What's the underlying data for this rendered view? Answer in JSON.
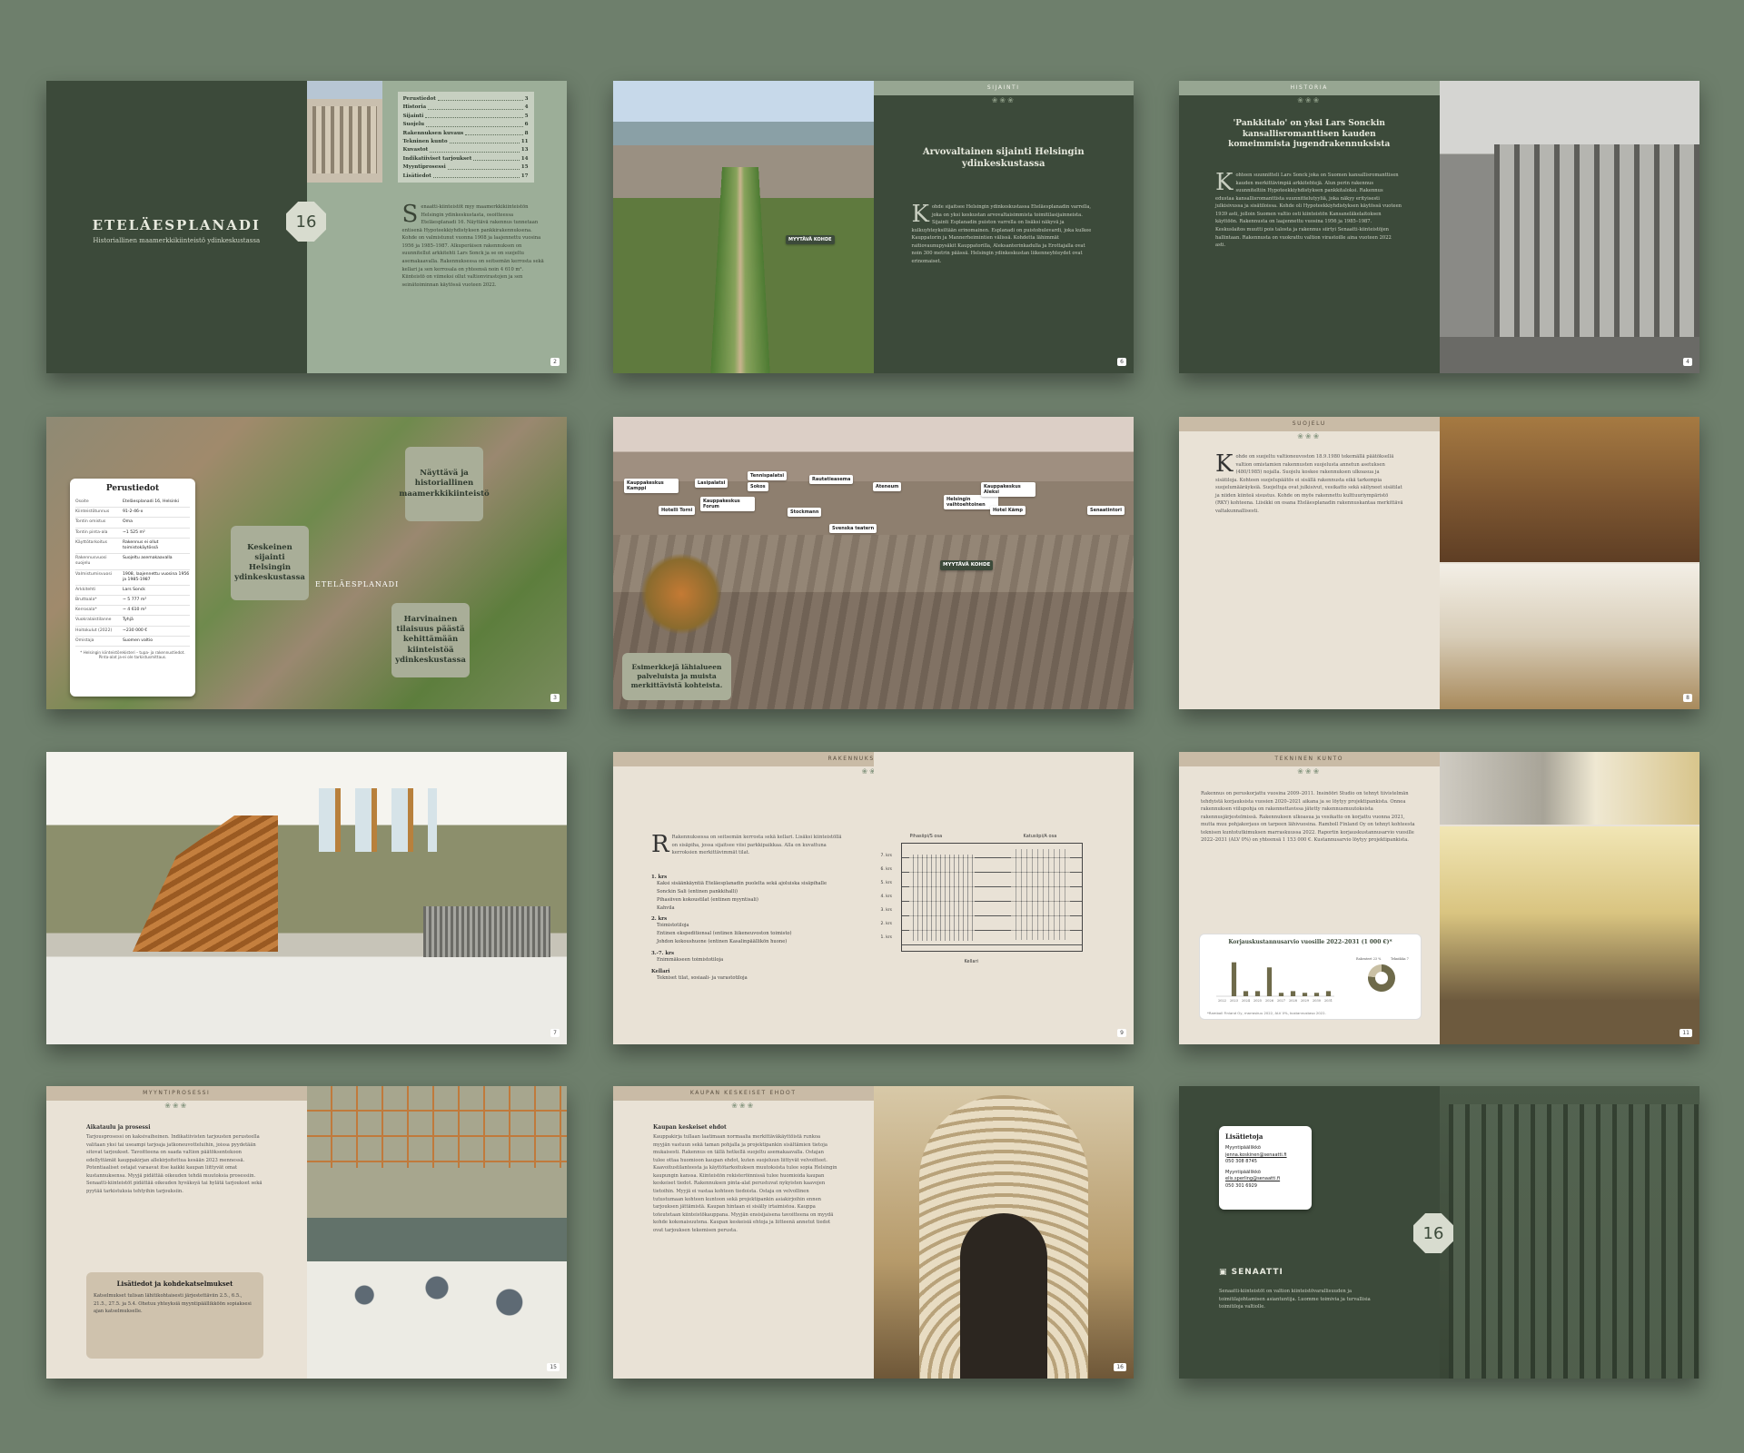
{
  "toc": {
    "items": [
      {
        "label": "Perustiedot",
        "page": "3"
      },
      {
        "label": "Historia",
        "page": "4"
      },
      {
        "label": "Sijainti",
        "page": "5"
      },
      {
        "label": "Suojelu",
        "page": "6"
      },
      {
        "label": "Rakennuksen kuvaus",
        "page": "8"
      },
      {
        "label": "Tekninen kunto",
        "page": "11"
      },
      {
        "label": "Kuvastot",
        "page": "13"
      },
      {
        "label": "Indikatiiviset tarjoukset",
        "page": "14"
      },
      {
        "label": "Myyntiprosessi",
        "page": "15"
      },
      {
        "label": "Lisätiedot",
        "page": "17"
      }
    ]
  },
  "cover": {
    "title": "ETELÄESPLANADI",
    "subtitle": "Historiallinen maamerkkikiinteistö ydinkeskustassa",
    "badge": "16",
    "page": "2"
  },
  "sijainti": {
    "band": "SIJAINTI",
    "heading": "Arvovaltainen sijainti Helsingin ydinkeskustassa",
    "marker": "MYYTÄVÄ KOHDE",
    "page": "6"
  },
  "historia": {
    "band": "HISTORIA",
    "heading": "'Pankkitalo' on yksi Lars Sonckin kansallisromanttisen kauden komeimmista jugendrakennuksista",
    "page": "4"
  },
  "perustiedot": {
    "title": "Perustiedot",
    "rows": [
      [
        "Osoite",
        "Eteläesplanadi 16, Helsinki"
      ],
      [
        "Kiinteistötunnus",
        "91-2-46-x"
      ],
      [
        "Tontin omistus",
        "Oma"
      ],
      [
        "Tontin pinta-ala",
        "~1 525 m²"
      ],
      [
        "Käyttötarkoitus",
        "Rakennus ei ollut toimistokäytössä"
      ],
      [
        "Rakennusvuosi suojelu",
        "Suojeltu asemakaavalla"
      ],
      [
        "Valmistumisvuosi",
        "1908, laajennettu vuosina 1956 ja 1985-1987"
      ],
      [
        "Arkkitehti",
        "Lars Sonck"
      ],
      [
        "Bruttoala*",
        "~ 5 777 m²"
      ],
      [
        "Kerrosala*",
        "~ 4 610 m²"
      ],
      [
        "Vuokralaistilanne",
        "Tyhjä"
      ],
      [
        "Hoitokulut (2022)",
        "~230 000 €"
      ],
      [
        "Omistaja",
        "Suomen valtio"
      ]
    ],
    "note": "* Helsingin kiinteistörekisteri – tupa- ja rakennustiedot. Pinta-alat ja-ei ole tarkistusmittaus.",
    "box1": "Näyttävä ja historiallinen maamerkkikiinteistö",
    "box2": "Keskeinen sijainti Helsingin ydinkeskustassa",
    "box3": "Harvinainen tilaisuus päästä kehittämään kiinteistöä ydinkeskustassa",
    "brand": "ETELÄESPLANADI",
    "page": "3"
  },
  "map": {
    "pins": [
      "Kauppakeskus Kamppi",
      "Lasipalatsi",
      "Tennispalatsi",
      "Kauppakeskus Forum",
      "Hotelli Torni",
      "Sokos",
      "Rautatieasema",
      "Stockmann",
      "Svenska teatern",
      "Ateneum",
      "Helsingin vaihtoehtoinen",
      "Kauppakeskus Aleksi",
      "Hotel Kämp",
      "Senaatintori"
    ],
    "marker": "MYYTÄVÄ KOHDE",
    "caption": "Esimerkkejä lähialueen palveluista ja muista merkittävistä kohteista."
  },
  "suojelu": {
    "band": "SUOJELU",
    "page": "8"
  },
  "stair": {
    "page": "7"
  },
  "rakennus": {
    "band": "RAKENNUKSEN KUVAUS",
    "intro": "Rakennuksessa on seitsemän kerrosta sekä kellari. Lisäksi kiinteistöllä on sisäpiha, jossa sijaitsee viisi parkkipaikkaa. Alla on kuvattuna kerroksien merkittävimmät tilat.",
    "floors": [
      {
        "label": "1. krs",
        "items": [
          "Kaksi sisäänkäyntiä Eteläesplanadin puolelta sekä ajoluiska sisäpihalle",
          "Sonckin Sali (entinen pankkihalli)",
          "Pihasiiven kokoustilat (entinen myyntisali)",
          "Kahvila"
        ]
      },
      {
        "label": "2. krs",
        "items": [
          "Toimistotiloja",
          "Entinen ekspeditionsal (entinen liikeneuvoston toimisto)",
          "Johdon kokoushuone (entinen Kasalinpäällikön huone)"
        ]
      },
      {
        "label": "3.-7. krs",
        "items": [
          "Enimmäkseen toimistotiloja"
        ]
      },
      {
        "label": "Kellari",
        "items": [
          "Tekniset tilat, sosiaali- ja varastotiloja"
        ]
      }
    ],
    "sec1": "Pihasiipi/S osa",
    "sec2": "Katusiipi/A osa",
    "levels": [
      "7. krs",
      "6. krs",
      "5. krs",
      "4. krs",
      "3. krs",
      "2. krs",
      "1. krs"
    ],
    "kellari": "Kellari",
    "page": "9"
  },
  "tekninen": {
    "band": "TEKNINEN KUNTO",
    "chart_title": "Korjauskustannusarvio vuosille 2022–2031 (1 000 €)*",
    "note": "*Ramboll Finland Oy, marraskuu 2022, ALV 0%, kustannustaso 2022.",
    "page": "11"
  },
  "chart_data": {
    "type": "bar",
    "categories": [
      "2022",
      "2023",
      "2024",
      "2025",
      "2026",
      "2027",
      "2028",
      "2029",
      "2030",
      "2031"
    ],
    "values": [
      0,
      40,
      6,
      6,
      34,
      4,
      6,
      4,
      4,
      6
    ],
    "title": "Korjauskustannusarvio vuosille 2022–2031 (1 000 €) *",
    "xlabel": "",
    "ylabel": "",
    "series": [
      {
        "values": [
          0,
          40,
          6,
          6,
          34,
          4,
          6,
          4,
          4,
          6
        ]
      }
    ],
    "pie": {
      "type": "pie",
      "values": [
        77,
        23
      ],
      "legend": [
        "Rakenteet 23 %",
        "Tekniikka 77 %"
      ]
    }
  },
  "myynti": {
    "band": "MYYNTIPROSESSI",
    "heading": "Aikataulu ja prosessi",
    "box_title": "Lisätiedot ja kohdekatselmukset",
    "box_text": "Katselmukset tulisan lähitikohtaisesti järjestettäviin 2.5., 6.5., 21.5., 27.5. ja 5.4. Ohetuu yhteyksiä myyntipäällikköön sopiaksesi ajan katselmukselle.",
    "page": "15"
  },
  "kauppa": {
    "band": "KAUPAN KESKEISET EHDOT",
    "heading": "Kaupan keskeiset ehdot",
    "page": "16"
  },
  "contact": {
    "title": "Lisätietoja",
    "p1_role": "Myyntipäällikkö",
    "p1_name": "jenna.koskinen@senaatti.fi",
    "p1_phone": "050 308 8745",
    "p2_role": "Myyntipäällikkö",
    "p2_name": "elis.sperling@senaatti.fi",
    "p2_phone": "050 301 6929",
    "badge": "16",
    "brand": "SENAATTI"
  },
  "colors": {
    "dark_green": "#3c4a3a",
    "sage": "#9cae98",
    "beige": "#e9e2d6",
    "tan_band": "#c9bba6",
    "background": "#6e7f6c"
  }
}
